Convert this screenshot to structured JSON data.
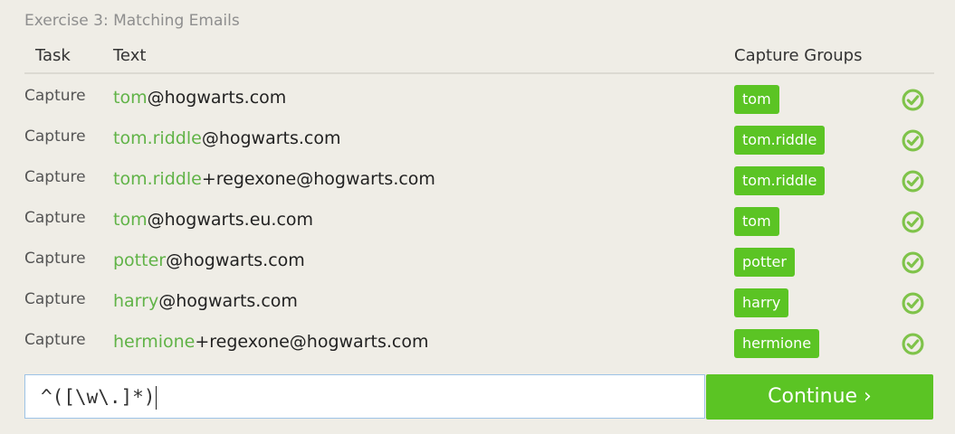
{
  "exercise": {
    "title": "Exercise 3: Matching Emails"
  },
  "table": {
    "headers": {
      "task": "Task",
      "text": "Text",
      "groups": "Capture Groups"
    },
    "rows": [
      {
        "task": "Capture",
        "match": "tom",
        "rest": "@hogwarts.com",
        "group": "tom"
      },
      {
        "task": "Capture",
        "match": "tom.riddle",
        "rest": "@hogwarts.com",
        "group": "tom.riddle"
      },
      {
        "task": "Capture",
        "match": "tom.riddle",
        "rest": "+regexone@hogwarts.com",
        "group": "tom.riddle"
      },
      {
        "task": "Capture",
        "match": "tom",
        "rest": "@hogwarts.eu.com",
        "group": "tom"
      },
      {
        "task": "Capture",
        "match": "potter",
        "rest": "@hogwarts.com",
        "group": "potter"
      },
      {
        "task": "Capture",
        "match": "harry",
        "rest": "@hogwarts.com",
        "group": "harry"
      },
      {
        "task": "Capture",
        "match": "hermione",
        "rest": "+regexone@hogwarts.com",
        "group": "hermione"
      }
    ],
    "status_icon": "check-circle-icon"
  },
  "input": {
    "value": "^([\\w\\.]*)"
  },
  "continue_button": {
    "label": "Continue ›"
  },
  "colors": {
    "accent": "#5bc424",
    "match_text": "#60b347",
    "background": "#efede6"
  }
}
